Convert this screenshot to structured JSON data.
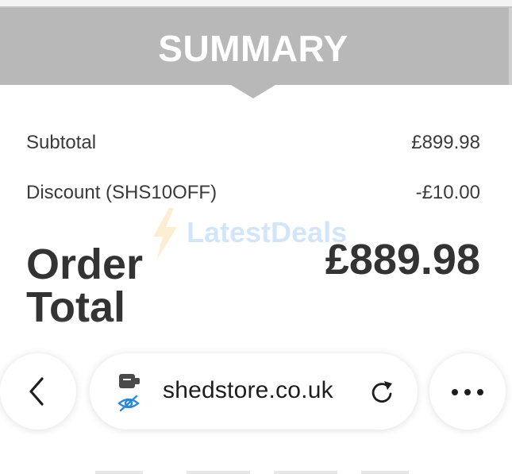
{
  "summary": {
    "title": "SUMMARY"
  },
  "rows": [
    {
      "label": "Subtotal",
      "value": "£899.98"
    },
    {
      "label": "Discount (SHS10OFF)",
      "value": "-£10.00"
    }
  ],
  "order_total": {
    "label": "Order Total",
    "value": "£889.98"
  },
  "watermark": {
    "text": "LatestDeals"
  },
  "browser": {
    "url": "shedstore.co.uk",
    "icons": [
      "back-chevron-icon",
      "site-extension-icon",
      "hidden-eye-icon",
      "reload-icon",
      "more-dots-icon"
    ]
  },
  "colors": {
    "header_bg": "#b8b8b8",
    "header_text": "#ffffff",
    "text": "#333333",
    "watermark_blue": "#3b8ee6",
    "privacy_blue": "#2a88d8"
  }
}
